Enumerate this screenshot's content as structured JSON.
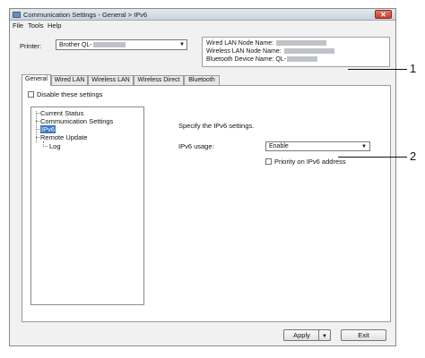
{
  "window": {
    "title": "Communication Settings - General > IPv6",
    "icon": "app-icon",
    "close_glyph": "✕"
  },
  "menu": [
    "File",
    "Tools",
    "Help"
  ],
  "printer": {
    "label": "Printer:",
    "selected": "Brother QL-"
  },
  "device_info": {
    "wired": "Wired LAN Node Name:",
    "wireless": "Wireless LAN Node Name:",
    "bluetooth": "Bluetooth Device Name: QL-"
  },
  "tabs": [
    "General",
    "Wired LAN",
    "Wireless LAN",
    "Wireless Direct",
    "Bluetooth"
  ],
  "active_tab": "General",
  "disable_settings_label": "Disable these settings",
  "tree": {
    "items": [
      "Current Status",
      "Communication Settings",
      "IPv6",
      "Remote Update",
      "Log"
    ],
    "selected": "IPv6"
  },
  "content": {
    "instruction": "Specify the IPv6 settings.",
    "usage_label": "IPv6 usage:",
    "usage_value": "Enable",
    "priority_label": "Priority on IPv6 address"
  },
  "buttons": {
    "apply": "Apply",
    "exit": "Exit"
  },
  "callouts": [
    "1",
    "2"
  ],
  "colors": {
    "selection": "#3a78c8",
    "close": "#c2402c"
  }
}
